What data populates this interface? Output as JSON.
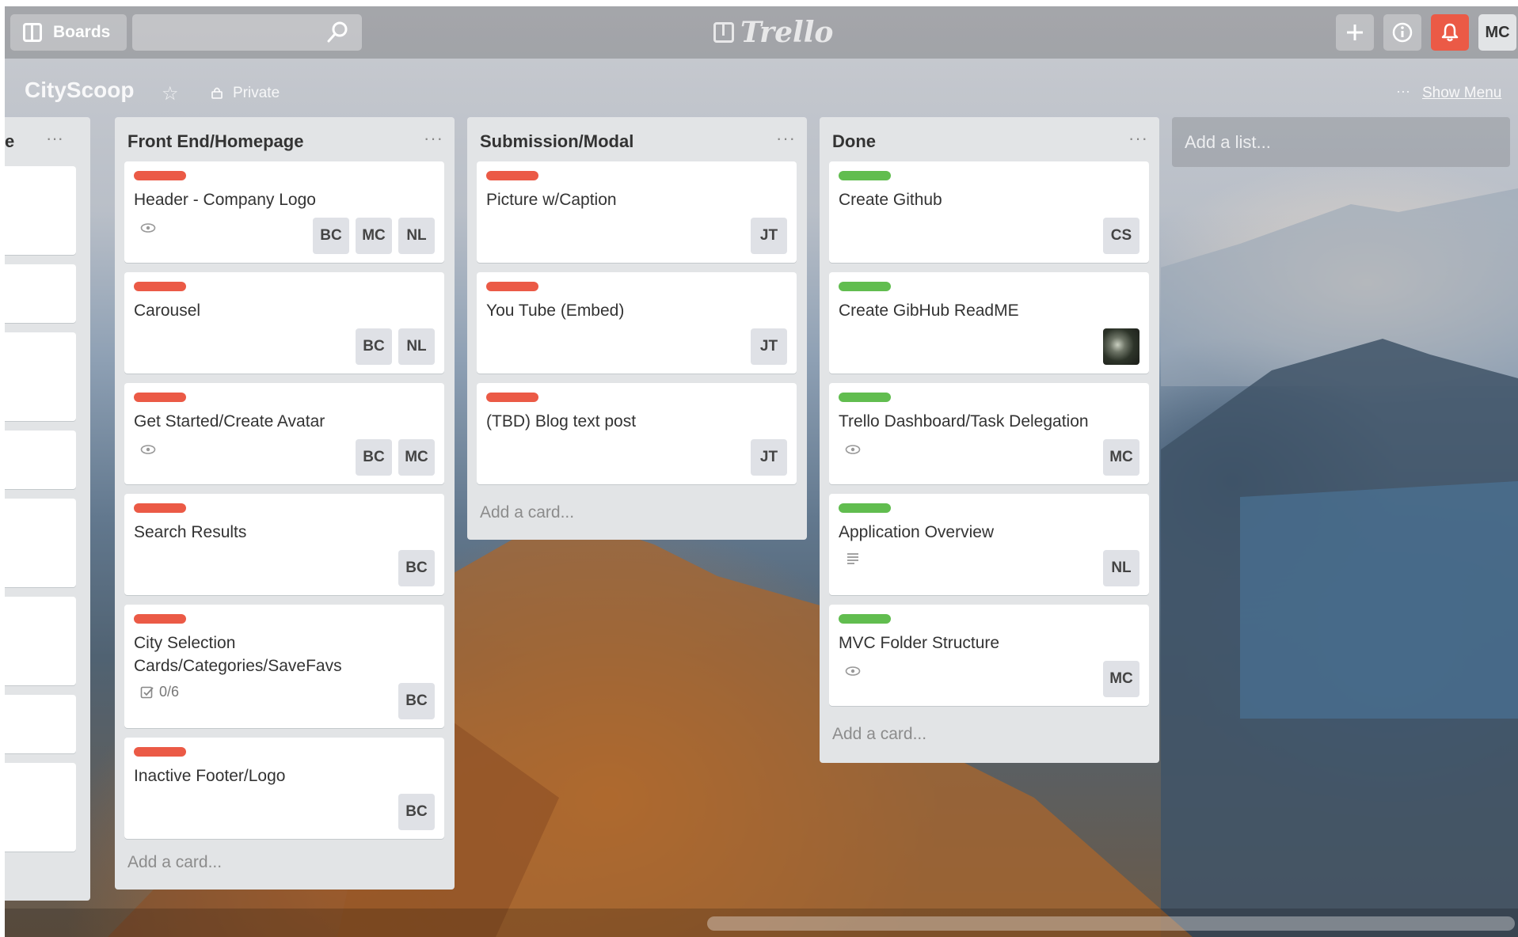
{
  "topbar": {
    "boards_label": "Boards",
    "search_placeholder": "",
    "logo_text": "Trello",
    "member_initials": "MC"
  },
  "board": {
    "title": "CityScoop",
    "visibility": "Private",
    "show_menu": "Show Menu"
  },
  "partial_list": {
    "title": "e",
    "menu": "···"
  },
  "lists": [
    {
      "title": "Front End/Homepage",
      "menu": "···",
      "add_card": "Add a card...",
      "cards": [
        {
          "label_color": "red",
          "title": "Header - Company Logo",
          "badge": "eye",
          "members": [
            "BC",
            "MC",
            "NL"
          ]
        },
        {
          "label_color": "red",
          "title": "Carousel",
          "members": [
            "BC",
            "NL"
          ]
        },
        {
          "label_color": "red",
          "title": "Get Started/Create Avatar",
          "badge": "eye",
          "members": [
            "BC",
            "MC"
          ]
        },
        {
          "label_color": "red",
          "title": "Search Results",
          "members": [
            "BC"
          ]
        },
        {
          "label_color": "red",
          "title_line1": "City Selection",
          "title_line2": "Cards/Categories/SaveFavs",
          "checklist": "0/6",
          "members": [
            "BC"
          ]
        },
        {
          "label_color": "red",
          "title": "Inactive Footer/Logo",
          "members": [
            "BC"
          ]
        }
      ]
    },
    {
      "title": "Submission/Modal",
      "menu": "···",
      "add_card": "Add a card...",
      "cards": [
        {
          "label_color": "red",
          "title": "Picture w/Caption",
          "members": [
            "JT"
          ]
        },
        {
          "label_color": "red",
          "title": "You Tube (Embed)",
          "members": [
            "JT"
          ]
        },
        {
          "label_color": "red",
          "title": "(TBD) Blog text post",
          "members": [
            "JT"
          ]
        }
      ]
    },
    {
      "title": "Done",
      "menu": "···",
      "add_card": "Add a card...",
      "cards": [
        {
          "label_color": "green",
          "title": "Create Github",
          "members": [
            "CS"
          ]
        },
        {
          "label_color": "green",
          "title": "Create GibHub ReadME",
          "members": [
            "photo-avatar"
          ]
        },
        {
          "label_color": "green",
          "title": "Trello Dashboard/Task Delegation",
          "badge": "eye",
          "members": [
            "MC"
          ]
        },
        {
          "label_color": "green",
          "title": "Application Overview",
          "badge": "description",
          "members": [
            "NL"
          ]
        },
        {
          "label_color": "green",
          "title": "MVC Folder Structure",
          "badge": "eye",
          "members": [
            "MC"
          ]
        }
      ]
    }
  ],
  "add_list": "Add a list...",
  "colors": {
    "label_red": "#eb5a46",
    "label_green": "#61bd4f",
    "notification": "#eb5a46",
    "list_bg": "#e2e4e6"
  },
  "icons": [
    "boards-icon",
    "search-icon",
    "add-icon",
    "info-icon",
    "bell-icon",
    "star-icon",
    "lock-icon",
    "eye-icon",
    "description-icon",
    "checklist-icon"
  ]
}
